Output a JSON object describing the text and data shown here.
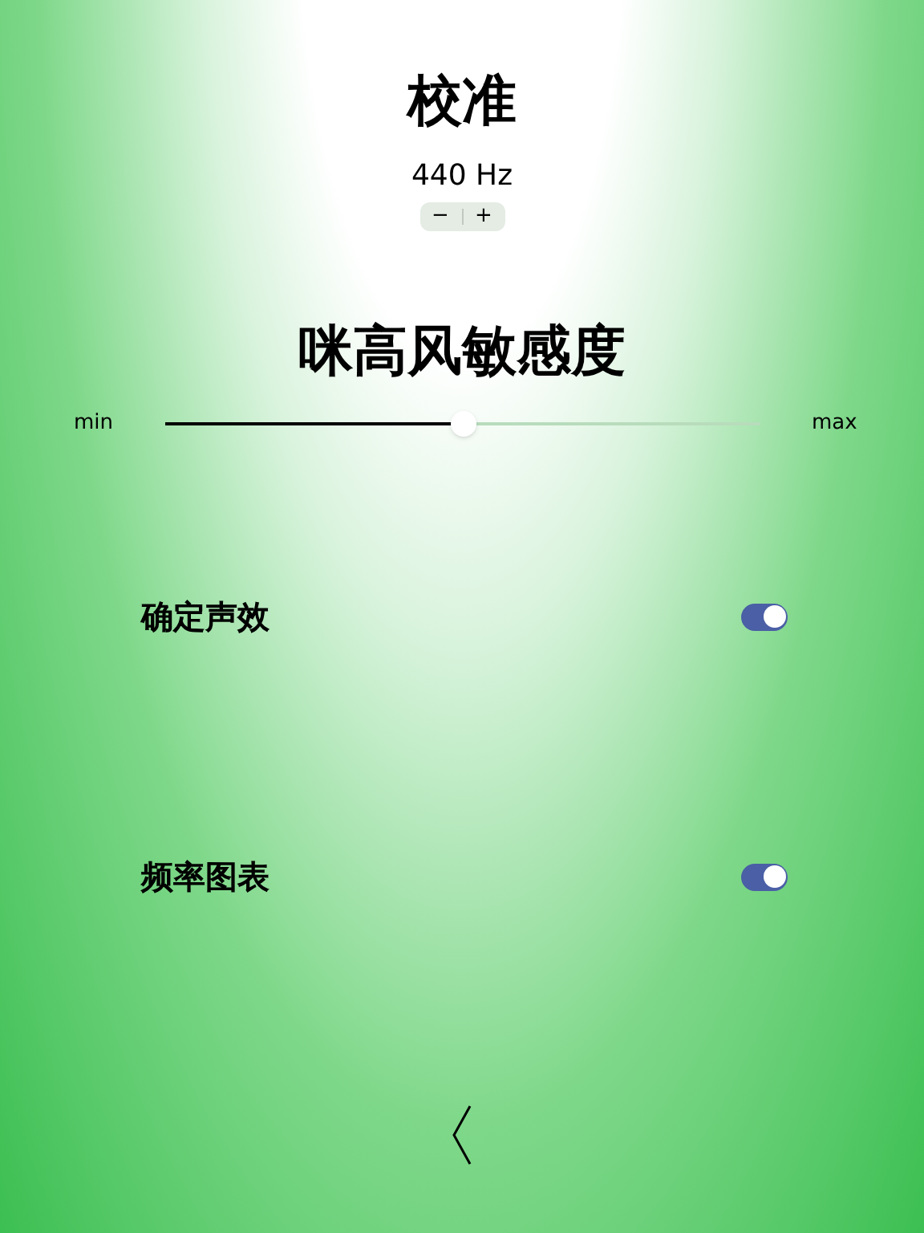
{
  "title": "校准",
  "frequency": {
    "reading": "440 Hz",
    "decrement": "−",
    "increment": "+"
  },
  "sensitivity": {
    "title": "咪高风敏感度",
    "min_label": "min",
    "max_label": "max",
    "level": 0.5
  },
  "toggles": [
    {
      "label": "确定声效",
      "on": true
    },
    {
      "label": "频率图表",
      "on": true
    }
  ]
}
